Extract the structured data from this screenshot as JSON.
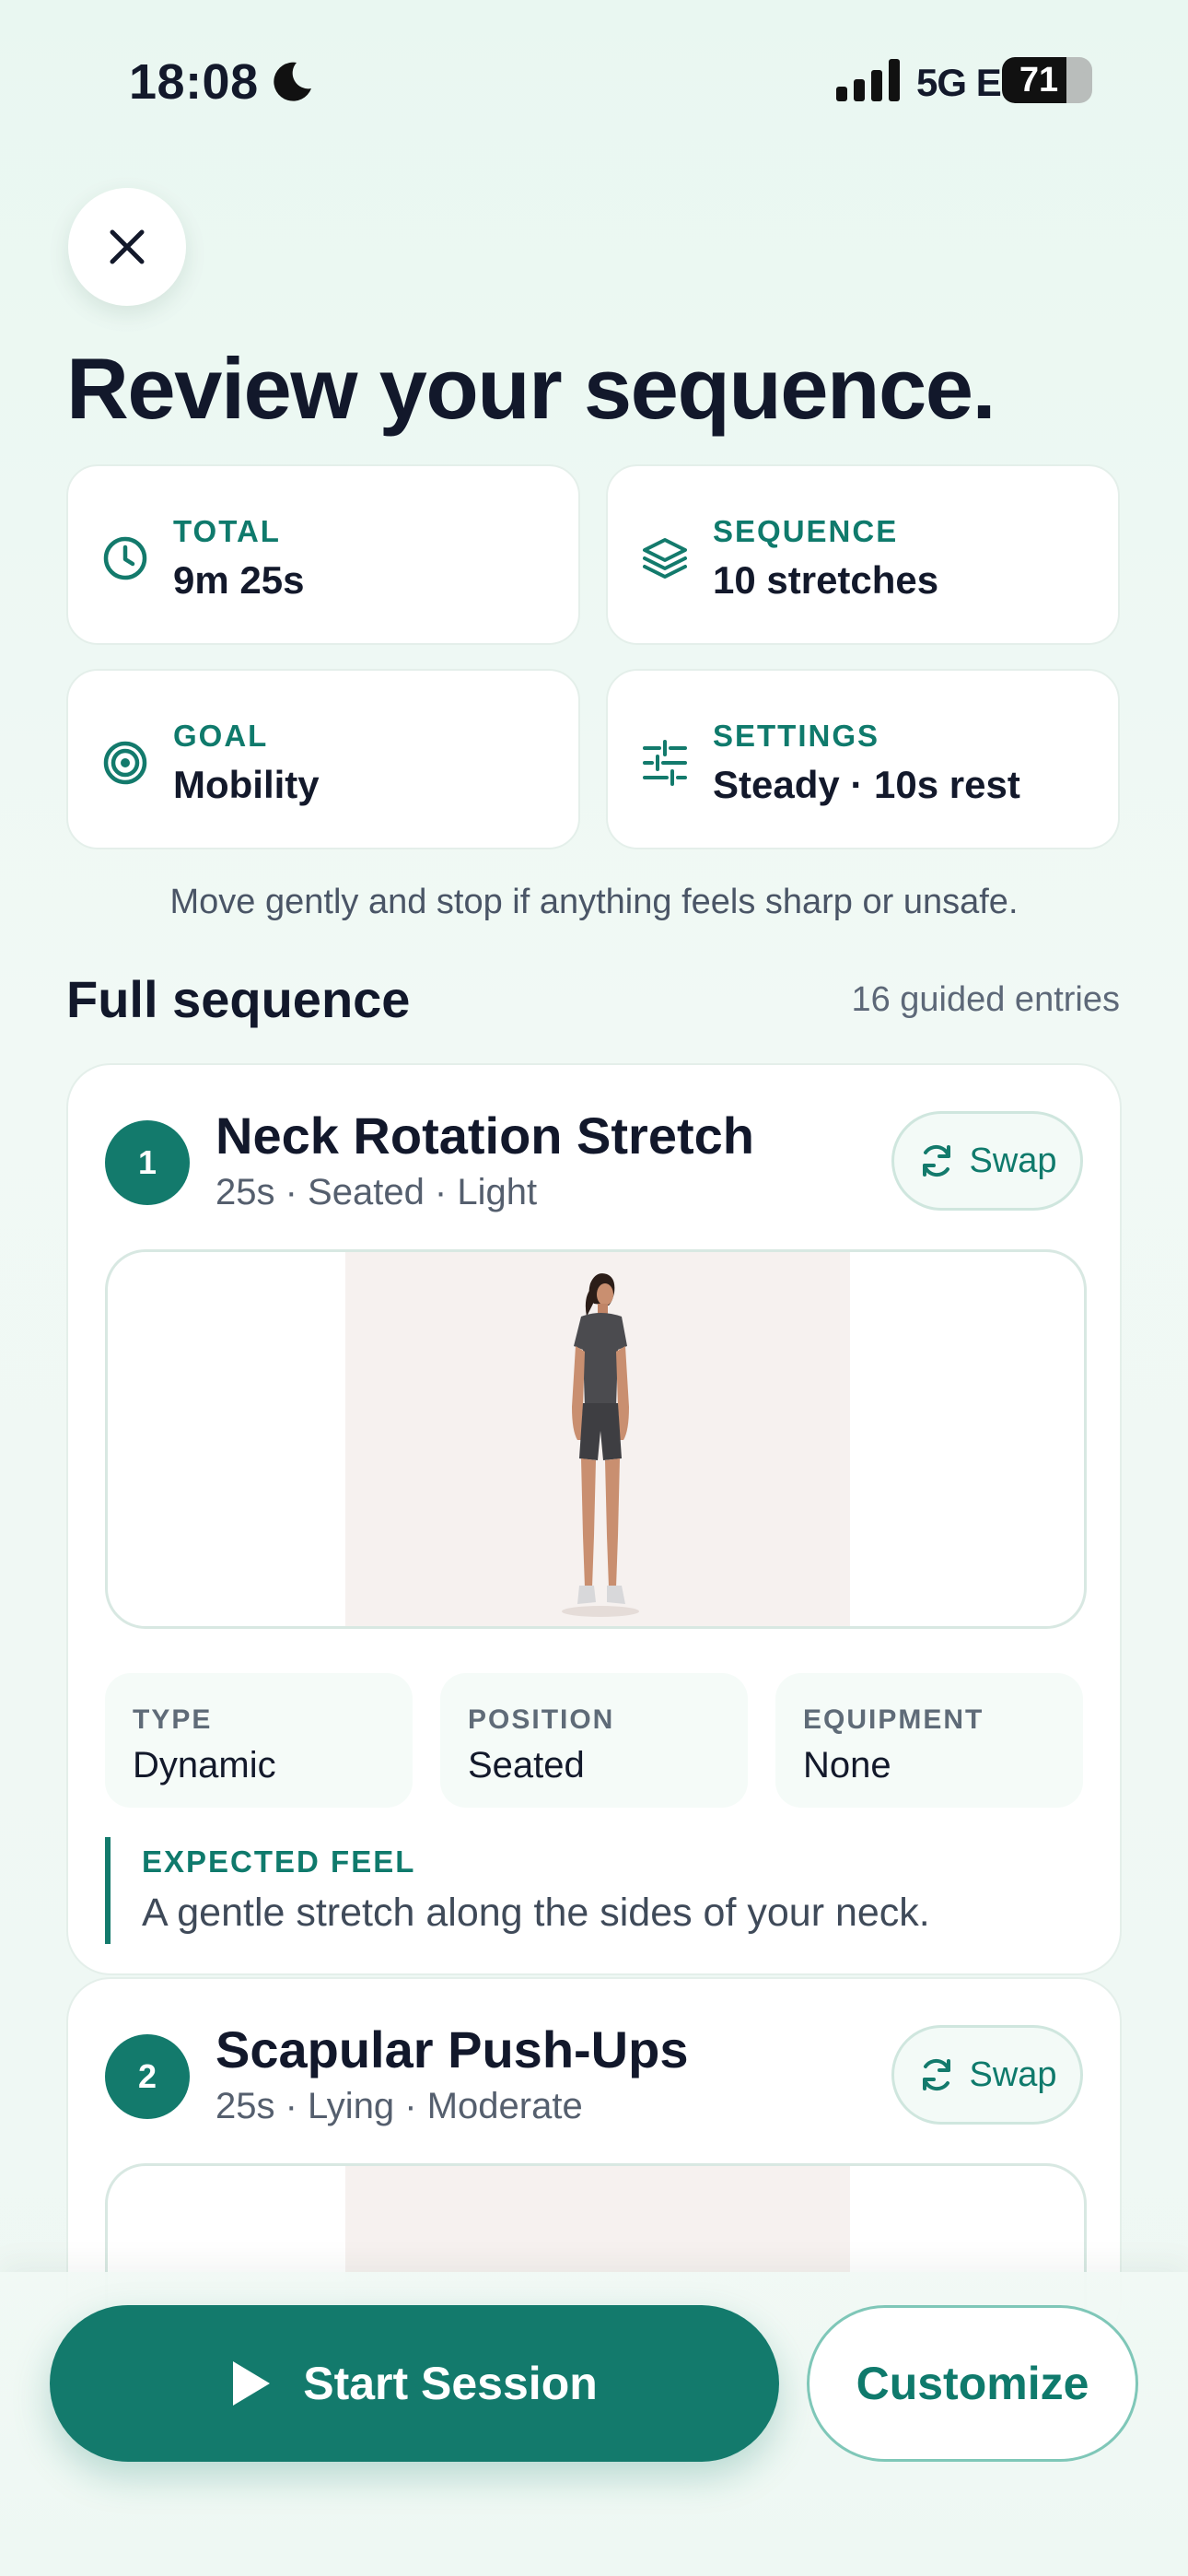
{
  "status_bar": {
    "time": "18:08",
    "network": "5G E",
    "battery_level": "71",
    "battery_fraction": 0.71,
    "icons": [
      "moon-icon",
      "signal-icon",
      "battery-icon"
    ]
  },
  "header": {
    "close_icon": "close-icon",
    "title": "Review your sequence."
  },
  "summary": [
    {
      "label": "TOTAL",
      "value": "9m 25s",
      "icon": "clock-icon"
    },
    {
      "label": "SEQUENCE",
      "value": "10 stretches",
      "icon": "layers-icon"
    },
    {
      "label": "GOAL",
      "value": "Mobility",
      "icon": "target-icon"
    },
    {
      "label": "SETTINGS",
      "value": "Steady · 10s rest",
      "icon": "sliders-icon"
    }
  ],
  "note": "Move gently and stop if anything feels sharp or unsafe.",
  "sequence": {
    "title": "Full sequence",
    "count": "16 guided entries",
    "items": [
      {
        "number": "1",
        "name": "Neck Rotation Stretch",
        "meta": "25s · Seated · Light",
        "swap_label": "Swap",
        "details": [
          {
            "label": "TYPE",
            "value": "Dynamic"
          },
          {
            "label": "POSITION",
            "value": "Seated"
          },
          {
            "label": "EQUIPMENT",
            "value": "None"
          }
        ],
        "feel_label": "EXPECTED FEEL",
        "feel_text": "A gentle stretch along the sides of your neck."
      },
      {
        "number": "2",
        "name": "Scapular Push-Ups",
        "meta": "25s · Lying · Moderate",
        "swap_label": "Swap"
      }
    ]
  },
  "actions": {
    "start_label": "Start Session",
    "customize_label": "Customize"
  },
  "colors": {
    "accent": "#137a6c",
    "title": "#12182b",
    "background": "#edf8f3"
  }
}
